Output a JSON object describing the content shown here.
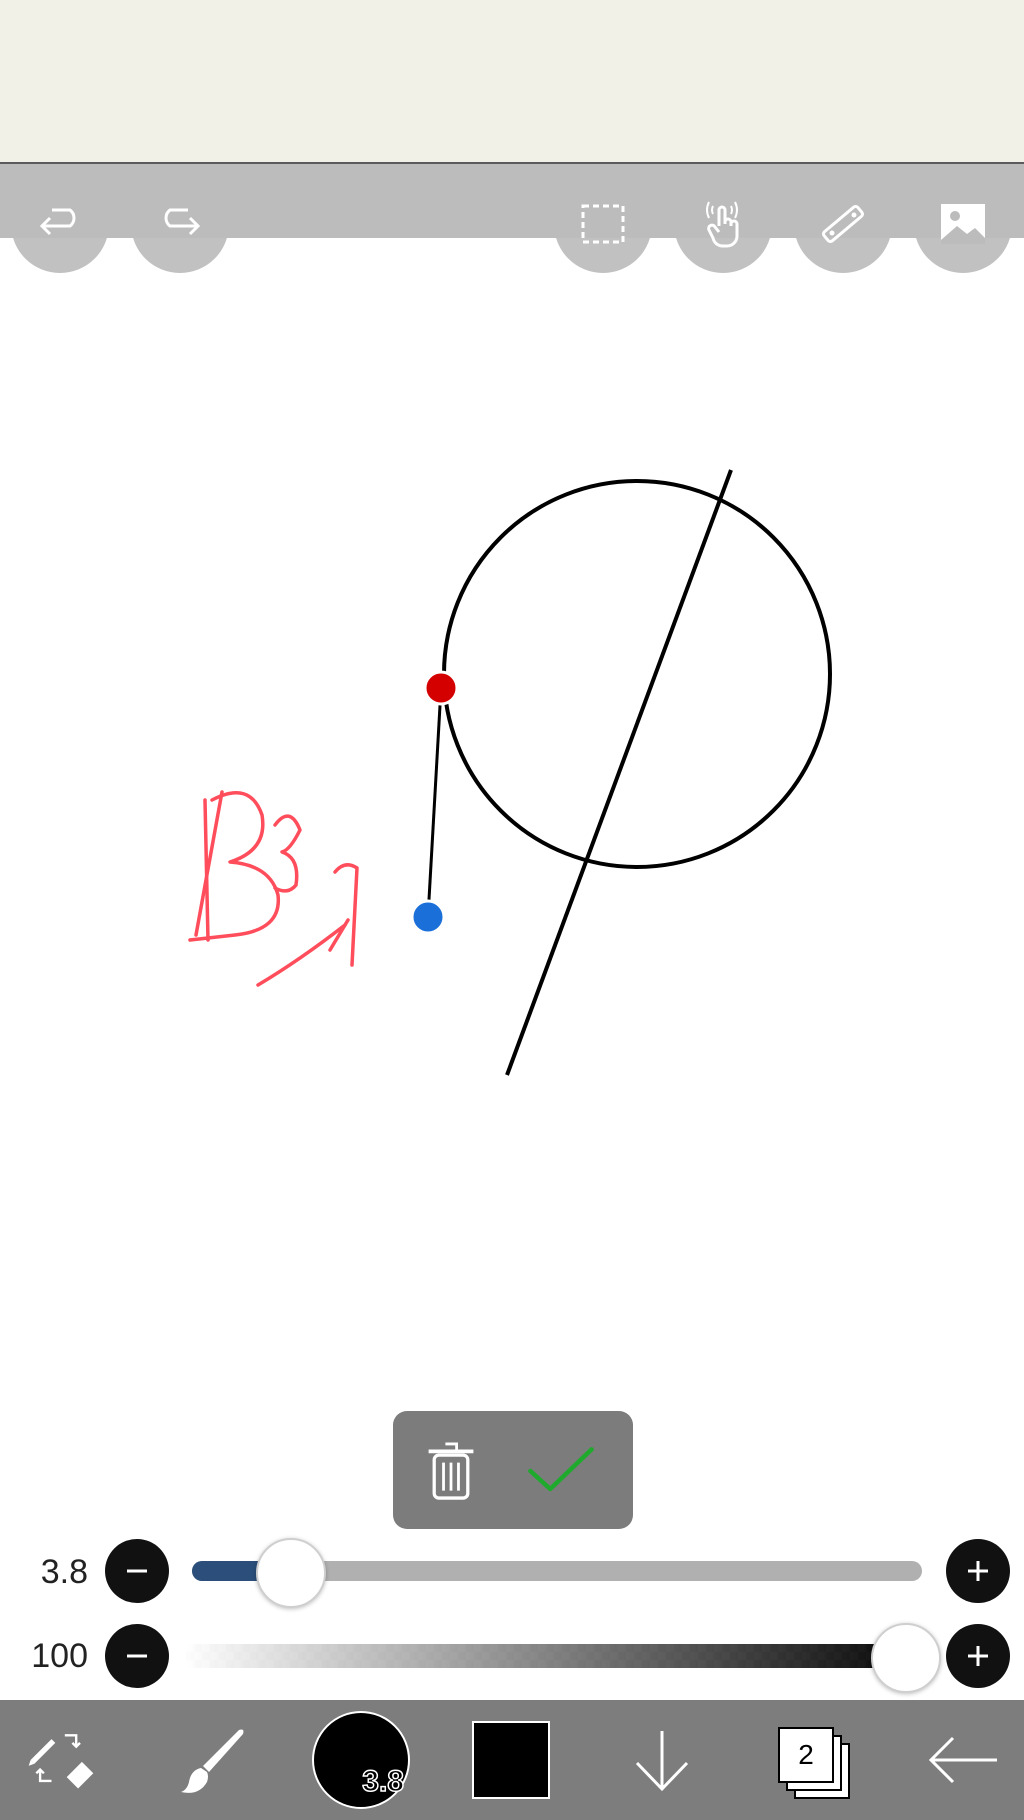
{
  "top_toolbar": {
    "undo": "undo-icon",
    "redo": "redo-icon",
    "selection": "selection-icon",
    "gesture": "hand-touch-icon",
    "ruler": "ruler-icon",
    "image": "image-icon"
  },
  "canvas": {
    "stroke_color": "#000000",
    "ink_color": "#ff4d5b",
    "handle_start_color": "#d40000",
    "handle_end_color": "#1a6fd8"
  },
  "popup": {
    "delete_icon": "trash-icon",
    "confirm_icon": "checkmark-icon",
    "confirm_color": "#1faa2e"
  },
  "sliders": {
    "size": {
      "label": "3.8",
      "value": 3.8,
      "fraction": 0.12
    },
    "opacity": {
      "label": "100",
      "value": 100,
      "fraction": 1.0
    }
  },
  "bottom_bar": {
    "tool_switch": "pen-eraser-toggle-icon",
    "brush": "brush-icon",
    "brush_size_label": "3.8",
    "color": "#000000",
    "move_down": "arrow-down-icon",
    "layers_count": "2",
    "back": "arrow-left-icon"
  }
}
